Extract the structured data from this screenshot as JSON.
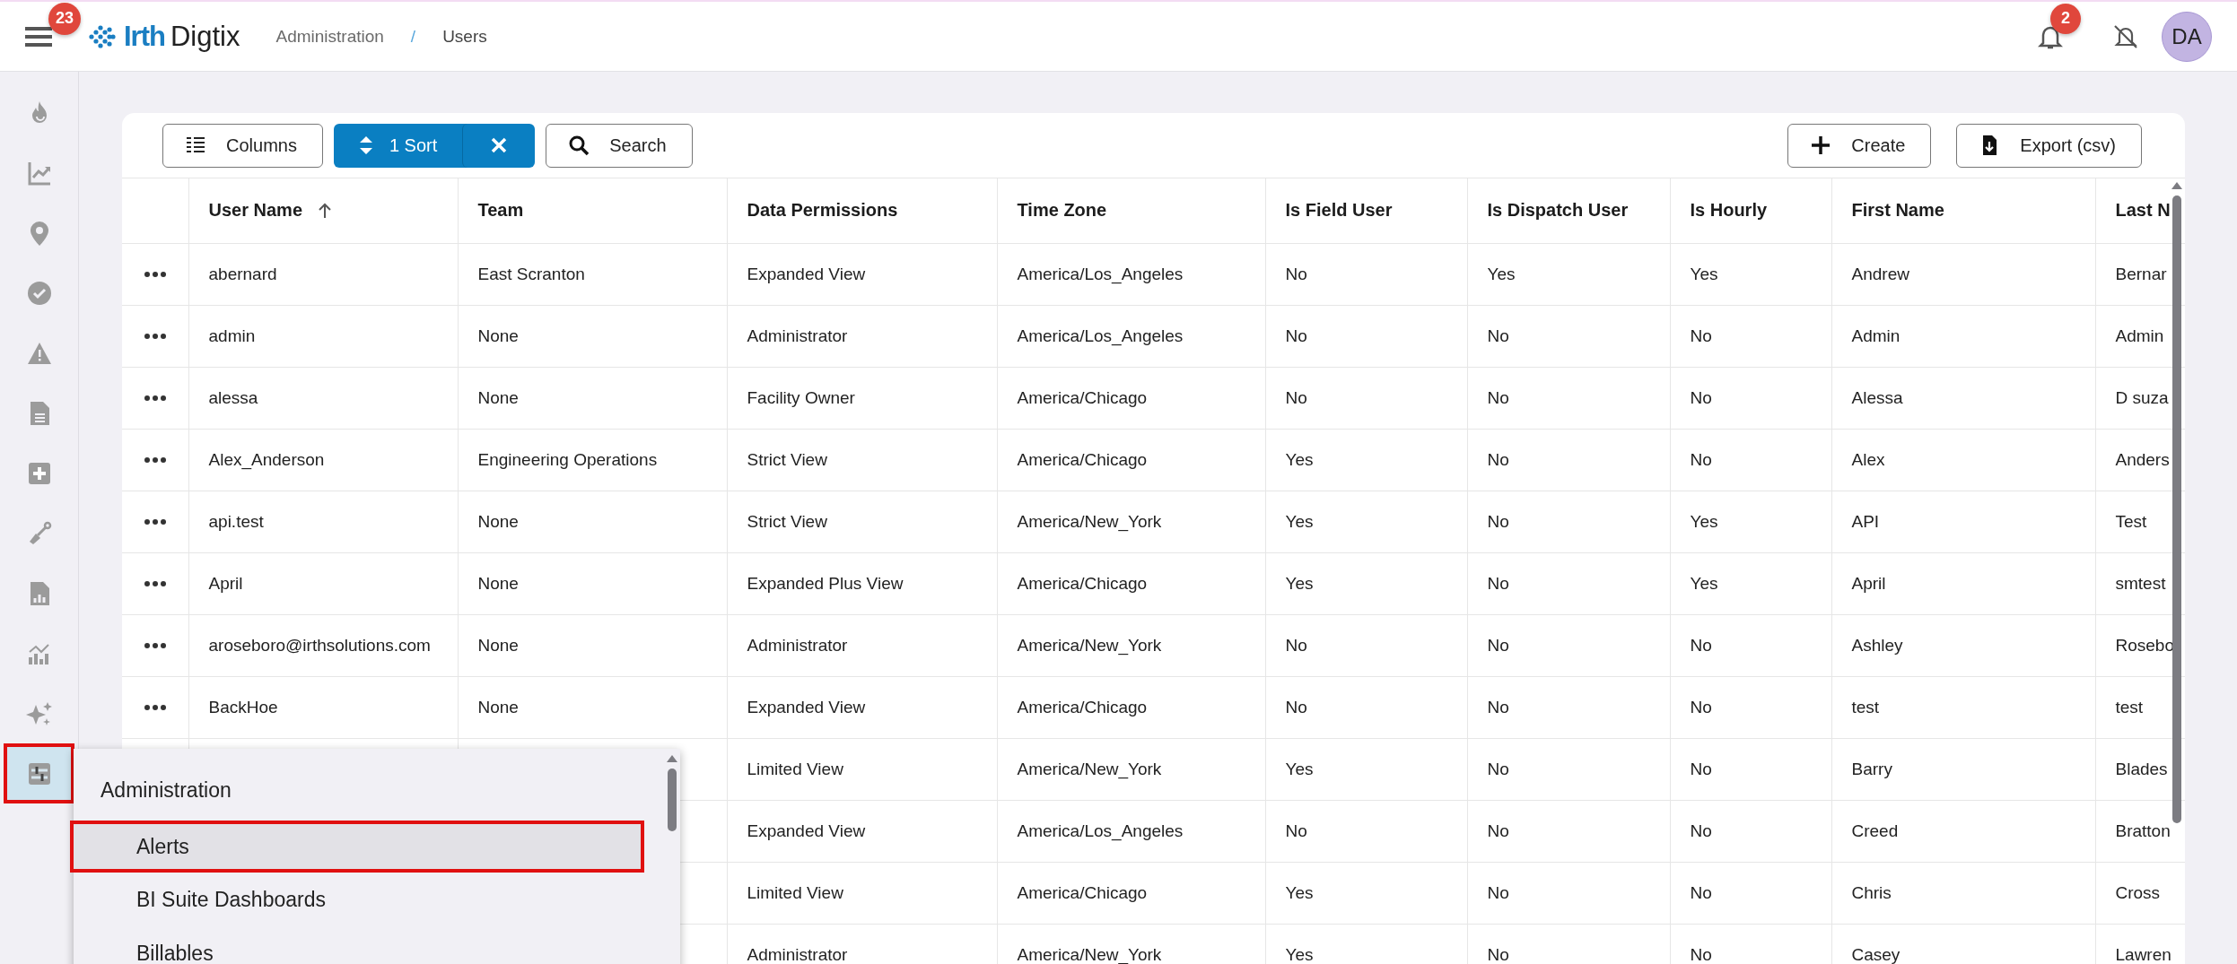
{
  "header": {
    "menu_badge": "23",
    "brand": "Irth",
    "product": "Digtix",
    "breadcrumbs": [
      "Administration",
      "/",
      "Users"
    ],
    "notification_badge": "2",
    "avatar": "DA"
  },
  "sidebar": {
    "items": [
      {
        "selected": false
      },
      {
        "selected": false
      },
      {
        "selected": false
      },
      {
        "selected": false
      },
      {
        "selected": false
      },
      {
        "selected": false
      },
      {
        "selected": false
      },
      {
        "selected": false
      },
      {
        "selected": false
      },
      {
        "selected": false
      },
      {
        "selected": false
      },
      {
        "selected": true
      }
    ]
  },
  "toolbar": {
    "columns_button": "Columns",
    "sort_button": "1 Sort",
    "search_button": "Search",
    "create_button": "Create",
    "export_button": "Export (csv)"
  },
  "table": {
    "columns": [
      {
        "label": "User Name",
        "sorted": true
      },
      {
        "label": "Team",
        "sorted": false
      },
      {
        "label": "Data Permissions",
        "sorted": false
      },
      {
        "label": "Time Zone",
        "sorted": false
      },
      {
        "label": "Is Field User",
        "sorted": false
      },
      {
        "label": "Is Dispatch User",
        "sorted": false
      },
      {
        "label": "Is Hourly",
        "sorted": false
      },
      {
        "label": "First Name",
        "sorted": false
      },
      {
        "label": "Last N",
        "sorted": false
      }
    ],
    "rows": [
      {
        "cells": [
          "abernard",
          "East Scranton",
          "Expanded View",
          "America/Los_Angeles",
          "No",
          "Yes",
          "Yes",
          "Andrew",
          "Bernar"
        ]
      },
      {
        "cells": [
          "admin",
          "None",
          "Administrator",
          "America/Los_Angeles",
          "No",
          "No",
          "No",
          "Admin",
          "Admin"
        ]
      },
      {
        "cells": [
          "alessa",
          "None",
          "Facility Owner",
          "America/Chicago",
          "No",
          "No",
          "No",
          "Alessa",
          "D suza"
        ]
      },
      {
        "cells": [
          "Alex_Anderson",
          "Engineering Operations",
          "Strict View",
          "America/Chicago",
          "Yes",
          "No",
          "No",
          "Alex",
          "Anders"
        ]
      },
      {
        "cells": [
          "api.test",
          "None",
          "Strict View",
          "America/New_York",
          "Yes",
          "No",
          "Yes",
          "API",
          "Test"
        ]
      },
      {
        "cells": [
          "April",
          "None",
          "Expanded Plus View",
          "America/Chicago",
          "Yes",
          "No",
          "Yes",
          "April",
          "smtest"
        ]
      },
      {
        "cells": [
          "aroseboro@irthsolutions.com",
          "None",
          "Administrator",
          "America/New_York",
          "No",
          "No",
          "No",
          "Ashley",
          "Rosebo"
        ]
      },
      {
        "cells": [
          "BackHoe",
          "None",
          "Expanded View",
          "America/Chicago",
          "No",
          "No",
          "No",
          "test",
          "test"
        ]
      },
      {
        "cells": [
          "",
          "",
          "Limited View",
          "America/New_York",
          "Yes",
          "No",
          "No",
          "Barry",
          "Blades"
        ]
      },
      {
        "cells": [
          "",
          "",
          "Expanded View",
          "America/Los_Angeles",
          "No",
          "No",
          "No",
          "Creed",
          "Bratton"
        ]
      },
      {
        "cells": [
          "",
          "",
          "Limited View",
          "America/Chicago",
          "Yes",
          "No",
          "No",
          "Chris",
          "Cross"
        ]
      },
      {
        "cells": [
          "",
          "",
          "Administrator",
          "America/New_York",
          "Yes",
          "No",
          "No",
          "Casey",
          "Lawren"
        ]
      }
    ]
  },
  "menu": {
    "title": "Administration",
    "items": [
      {
        "label": "Alerts",
        "selected": true
      },
      {
        "label": "BI Suite Dashboards",
        "selected": false
      },
      {
        "label": "Billables",
        "selected": false
      }
    ]
  }
}
